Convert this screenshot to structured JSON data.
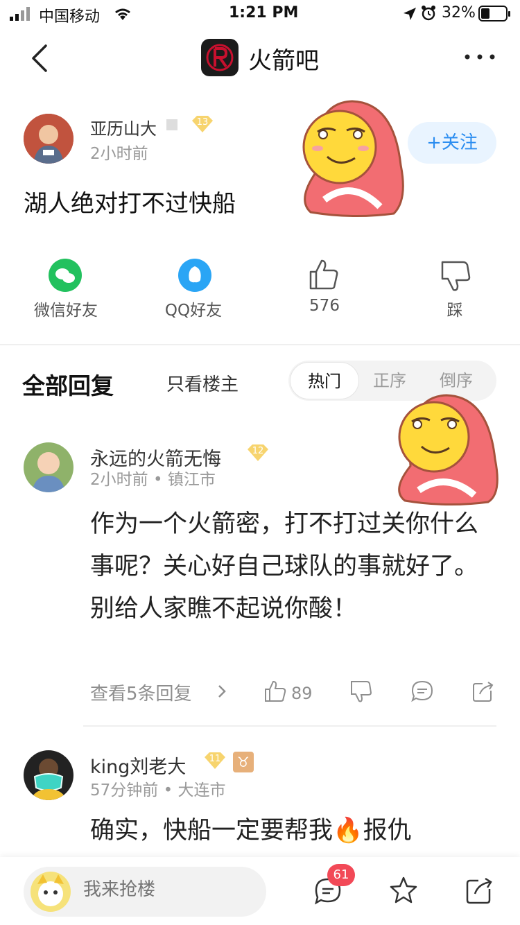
{
  "status_bar": {
    "carrier": "中国移动",
    "time": "1:21 PM",
    "battery_pct": "32%"
  },
  "nav": {
    "title": "火箭吧",
    "logo_icon": "rockets-logo-icon",
    "back_icon": "chevron-left-icon",
    "more_icon": "more-dots-icon"
  },
  "post": {
    "author": "亚历山大",
    "level": "13",
    "time": "2小时前",
    "follow_label": "+关注",
    "text": "湖人绝对打不过快船"
  },
  "share": {
    "wechat_label": "微信好友",
    "qq_label": "QQ好友",
    "like_count": "576",
    "dislike_label": "踩"
  },
  "tabs": {
    "all_replies": "全部回复",
    "op_only": "只看楼主",
    "sort_hot": "热门",
    "sort_asc": "正序",
    "sort_desc": "倒序"
  },
  "replies": [
    {
      "author": "永远的火箭无悔",
      "level": "12",
      "time_location": "2小时前 • 镇江市",
      "text": "作为一个火箭密，打不打过关你什么事呢？关心好自己球队的事就好了。别给人家瞧不起说你酸！",
      "view_replies": "查看5条回复",
      "like_count": "89"
    },
    {
      "author": "king刘老大",
      "level": "11",
      "zodiac": "♉",
      "time_location": "57分钟前 • 大连市",
      "text": "确实，快船一定要帮我🔥报仇"
    }
  ],
  "bottom_bar": {
    "placeholder": "我来抢楼",
    "comment_badge": "61"
  },
  "colors": {
    "accent": "#2b8df0",
    "wechat": "#22c15e",
    "qq": "#2aa5f5",
    "badge_red": "#f24957",
    "level_gold": "#f7d46e"
  }
}
